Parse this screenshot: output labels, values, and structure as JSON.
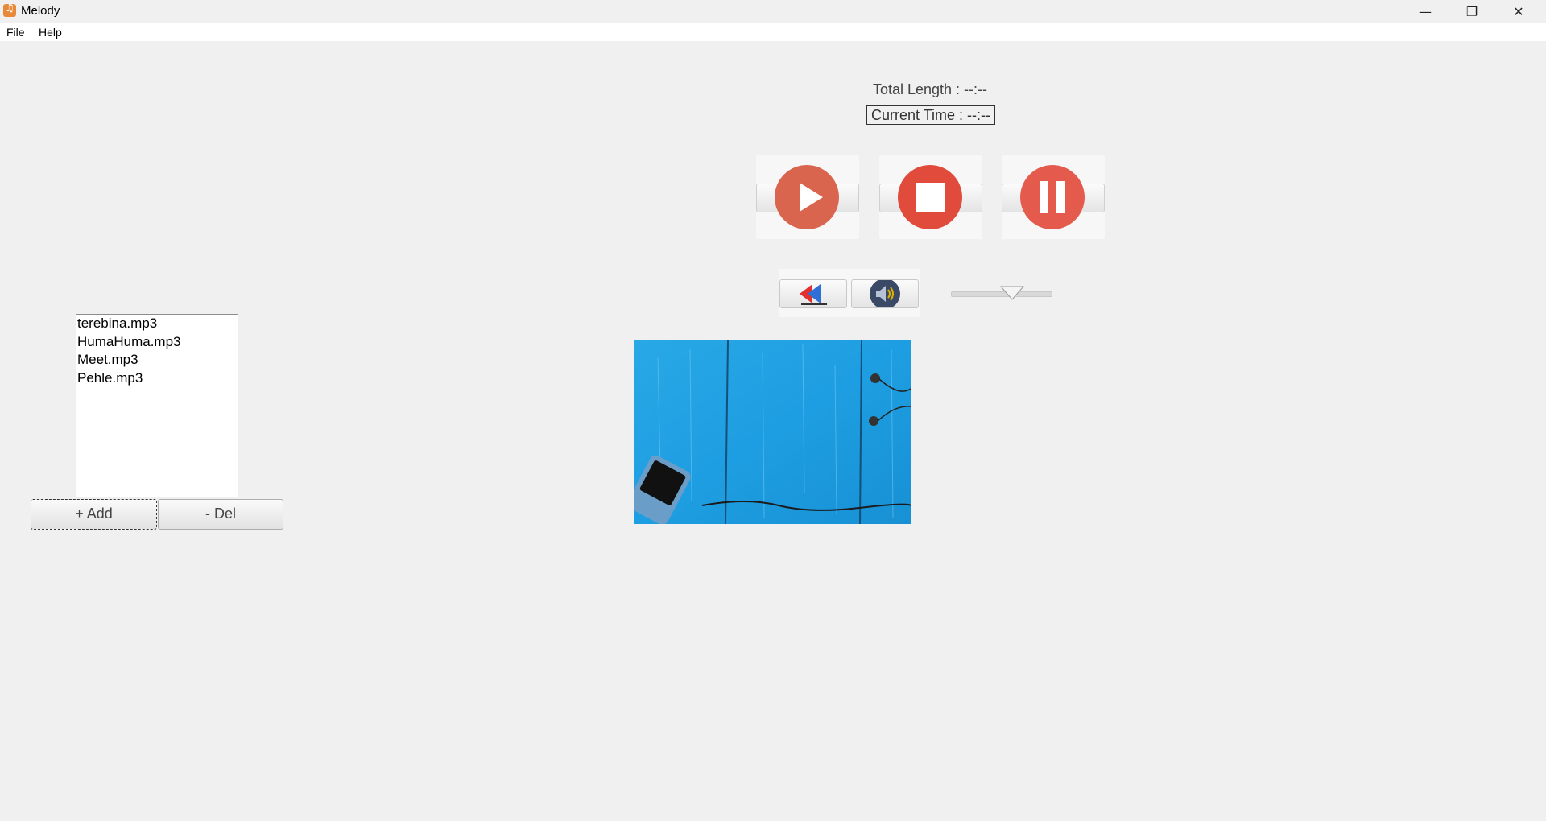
{
  "window": {
    "title": "Melody",
    "controls": {
      "minimize": "—",
      "maximize": "❐",
      "close": "✕"
    }
  },
  "menu": {
    "items": [
      "File",
      "Help"
    ]
  },
  "timing": {
    "total_length": "Total Length : --:--",
    "current_time": "Current Time : --:--"
  },
  "controls": {
    "play_icon": "play-icon",
    "stop_icon": "stop-icon",
    "pause_icon": "pause-icon",
    "rewind_icon": "rewind-icon",
    "volume_icon": "speaker-icon",
    "volume_level": 0.6
  },
  "colors": {
    "play": "#d9654f",
    "stop": "#e04b3c",
    "pause": "#e45a4d"
  },
  "playlist": {
    "items": [
      "terebina.mp3",
      "HumaHuma.mp3",
      "Meet.mp3",
      "Pehle.mp3"
    ]
  },
  "buttons": {
    "add": "+ Add",
    "del": "- Del"
  }
}
